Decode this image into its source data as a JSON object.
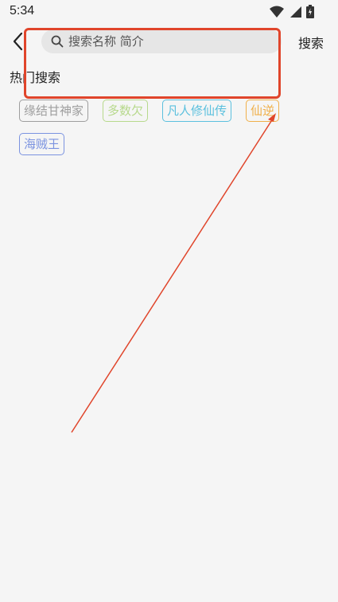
{
  "status_bar": {
    "time": "5:34",
    "icons": [
      "wifi-icon",
      "signal-icon",
      "battery-icon"
    ]
  },
  "top_bar": {
    "back_icon": "chevron-left-icon",
    "search": {
      "placeholder": "搜索名称 简介",
      "value": ""
    },
    "search_button_label": "搜索"
  },
  "hot_search": {
    "title": "热门搜索",
    "tags": [
      {
        "label": "缘结甘神家",
        "color": "#9e9e9e"
      },
      {
        "label": "多数欠",
        "color": "#b7d98c"
      },
      {
        "label": "凡人修仙传",
        "color": "#5bc0de"
      },
      {
        "label": "仙逆",
        "color": "#f0b04a"
      },
      {
        "label": "海贼王",
        "color": "#7b93e0"
      }
    ]
  },
  "colors": {
    "background": "#f5f5f5",
    "annotation": "#e0452b"
  }
}
